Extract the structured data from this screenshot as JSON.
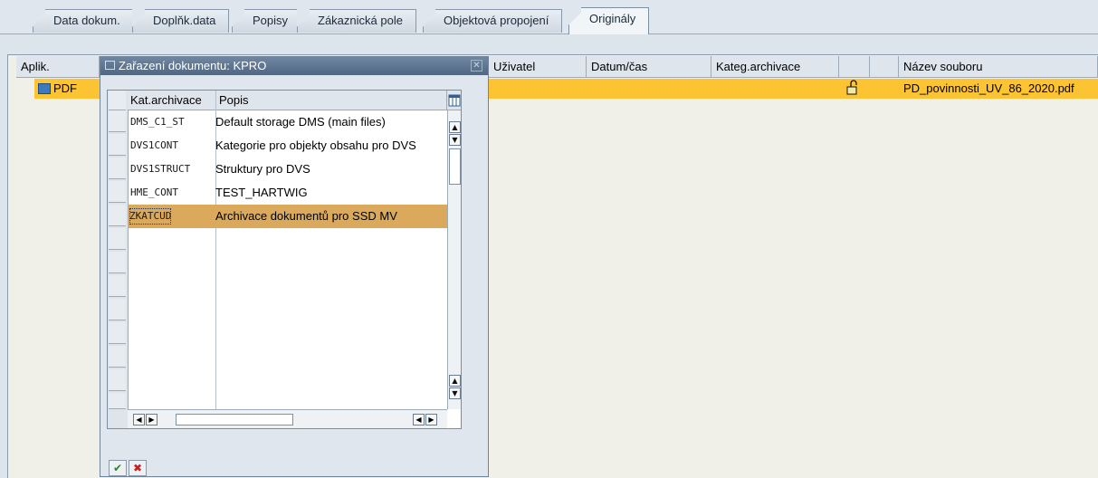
{
  "tabs": [
    "Data dokum.",
    "Doplňk.data",
    "Popisy",
    "Zákaznická pole",
    "Objektová propojení",
    "Originály"
  ],
  "main_table": {
    "headers": [
      "Aplik.",
      "Uživatel",
      "Datum/čas",
      "Kateg.archivace",
      "",
      "",
      "Název souboru"
    ],
    "row": {
      "aplik": "PDF",
      "filename": "PD_povinnosti_UV_86_2020.pdf"
    }
  },
  "dialog": {
    "title": "Zařazení dokumentu: KPRO",
    "col1_header": "Kat.archivace",
    "col2_header": "Popis",
    "rows": [
      {
        "code": "DMS_C1_ST",
        "desc": "Default storage DMS (main files)"
      },
      {
        "code": "DVS1CONT",
        "desc": "Kategorie pro objekty obsahu pro DVS"
      },
      {
        "code": "DVS1STRUCT",
        "desc": "Struktury pro DVS"
      },
      {
        "code": "HME_CONT",
        "desc": "TEST_HARTWIG"
      },
      {
        "code": "ZKATCUD",
        "desc": "Archivace dokumentů pro SSD MV"
      }
    ]
  },
  "colors": {
    "highlight": "#fcc332",
    "selected_row": "#dba95b",
    "title_bar": "#5b728d"
  }
}
